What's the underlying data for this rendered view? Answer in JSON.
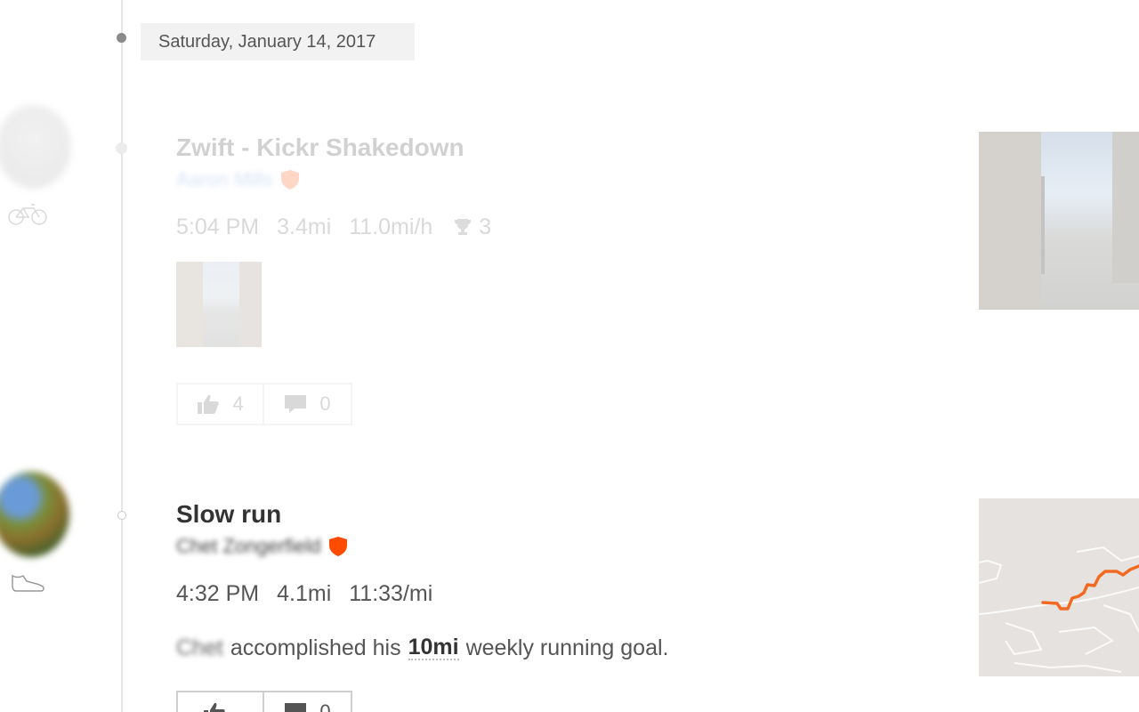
{
  "feed": {
    "date_header": "Saturday, January 14, 2017",
    "activities": [
      {
        "title": "Zwift - Kickr Shakedown",
        "athlete": "Aaron Mills",
        "sport_icon": "bike-icon",
        "time": "5:04 PM",
        "distance": "3.4mi",
        "pace": "11.0mi/h",
        "achievements": "3",
        "kudos_count": "4",
        "comment_count": "0"
      },
      {
        "title": "Slow run",
        "athlete": "Chet Zongerfield",
        "sport_icon": "shoe-icon",
        "time": "4:32 PM",
        "distance": "4.1mi",
        "pace": "11:33/mi",
        "goal": {
          "name": "Chet",
          "text_before": "accomplished his",
          "distance": "10mi",
          "text_after": "weekly running goal."
        },
        "kudos_count": "",
        "comment_count": "0"
      }
    ]
  },
  "colors": {
    "brand_orange": "#fc4c02",
    "route_orange": "#f26a21",
    "timeline_gray": "#e6e6e6"
  }
}
